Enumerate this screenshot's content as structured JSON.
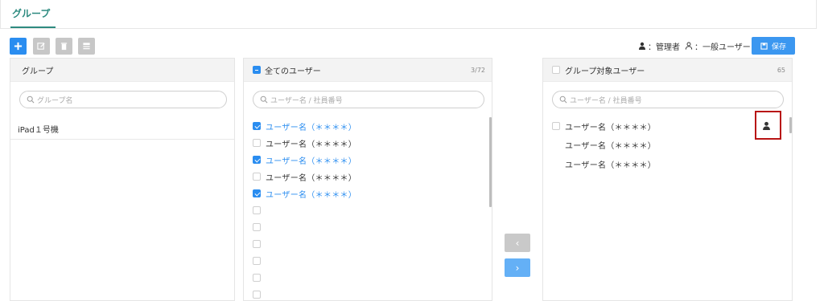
{
  "tabs": [
    {
      "label": "グループ",
      "active": true
    }
  ],
  "toolbar": {
    "add_icon": "plus-icon",
    "edit_icon": "edit-icon",
    "delete_icon": "trash-icon",
    "list_icon": "list-icon"
  },
  "legend": {
    "admin_label": "：管理者",
    "general_label": "：一般ユーザー"
  },
  "save_button": {
    "label": "保存",
    "icon": "save-icon"
  },
  "colors": {
    "accent": "#2a8df0",
    "tab": "#2e8b80",
    "highlight": "#b81414"
  },
  "group_panel": {
    "title": "グループ",
    "search_placeholder": "グループ名",
    "items": [
      "iPad１号機"
    ]
  },
  "all_users_panel": {
    "title": "全てのユーザー",
    "count": "3/72",
    "search_placeholder": "ユーザー名 / 社員番号",
    "rows": [
      {
        "label": "ユーザー名（＊＊＊＊）",
        "checked": true
      },
      {
        "label": "ユーザー名（＊＊＊＊）",
        "checked": false
      },
      {
        "label": "ユーザー名（＊＊＊＊）",
        "checked": true
      },
      {
        "label": "ユーザー名（＊＊＊＊）",
        "checked": false
      },
      {
        "label": "ユーザー名（＊＊＊＊）",
        "checked": true
      },
      {
        "label": "",
        "checked": false
      },
      {
        "label": "",
        "checked": false
      },
      {
        "label": "",
        "checked": false
      },
      {
        "label": "",
        "checked": false
      },
      {
        "label": "",
        "checked": false
      },
      {
        "label": "",
        "checked": false
      }
    ]
  },
  "transfer": {
    "left_label": "‹",
    "right_label": "›"
  },
  "group_users_panel": {
    "title": "グループ対象ユーザー",
    "count": "65",
    "search_placeholder": "ユーザー名 / 社員番号",
    "rows": [
      {
        "label": "ユーザー名（＊＊＊＊）"
      },
      {
        "label": "ユーザー名（＊＊＊＊）"
      },
      {
        "label": "ユーザー名（＊＊＊＊）"
      }
    ],
    "row_icon": "admin-user-icon"
  }
}
